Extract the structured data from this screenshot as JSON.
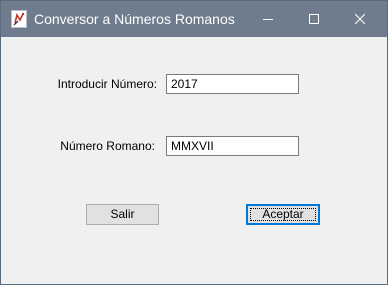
{
  "window": {
    "title": "Conversor a Números Romanos",
    "icon": "app-icon",
    "controls": {
      "minimize": "minimize-icon",
      "maximize": "maximize-icon",
      "close": "close-icon"
    }
  },
  "form": {
    "number_label": "Introducir Número:",
    "number_value": "2017",
    "roman_label": "Número Romano:",
    "roman_value": "MMXVII"
  },
  "buttons": {
    "exit_label": "Salir",
    "accept_label": "Aceptar"
  },
  "colors": {
    "titlebar": "#6e7c8d",
    "client": "#f0f0f0",
    "focus_accent": "#0078d7"
  }
}
